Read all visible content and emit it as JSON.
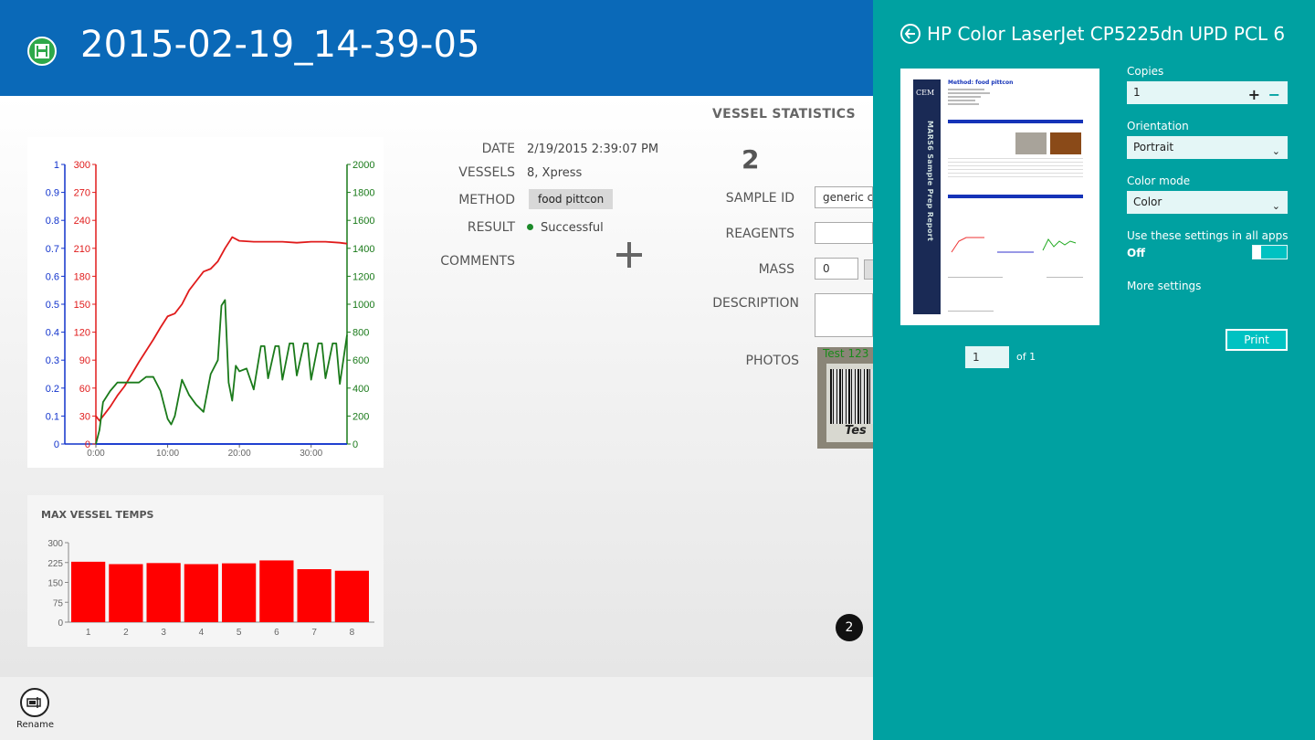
{
  "header": {
    "title": "2015-02-19_14-39-05",
    "save_icon": "save-icon"
  },
  "details": {
    "date_label": "DATE",
    "date_value": "2/19/2015 2:39:07 PM",
    "vessels_label": "VESSELS",
    "vessels_value": "8, Xpress",
    "method_label": "METHOD",
    "method_value": "food pittcon",
    "result_label": "RESULT",
    "result_value": "Successful",
    "comments_label": "COMMENTS"
  },
  "vessel_statistics": {
    "title": "VESSEL STATISTICS",
    "count": "2",
    "sample_id_label": "SAMPLE ID",
    "sample_id_value": "generic che",
    "reagents_label": "REAGENTS",
    "reagents_value": "",
    "mass_label": "MASS",
    "mass_value": "0",
    "description_label": "DESCRIPTION",
    "photos_label": "PHOTOS",
    "photo_caption": "Test 123",
    "photo_text": "Tes"
  },
  "badge": "2",
  "appbar": {
    "rename_label": "Rename"
  },
  "print_pane": {
    "printer_name": "HP Color LaserJet CP5225dn UPD PCL 6",
    "copies_label": "Copies",
    "copies_value": "1",
    "orientation_label": "Orientation",
    "orientation_value": "Portrait",
    "color_mode_label": "Color mode",
    "color_mode_value": "Color",
    "use_settings_label": "Use these settings in all apps",
    "use_settings_state": "Off",
    "more_settings": "More settings",
    "print_button": "Print",
    "page_value": "1",
    "page_of": "of 1",
    "preview": {
      "method_title": "Method:  food pittcon",
      "side_text": "MARS6 Sample Prep Report",
      "logo": "CEM"
    }
  },
  "colors": {
    "header_bg": "#0a69b8",
    "print_pane_bg": "#00a1a1",
    "temperature": "#e01b1b",
    "pressure": "#1133cc",
    "power": "#1a7a1a",
    "bar": "#ff0000"
  },
  "chart_data": [
    {
      "type": "line",
      "title": "",
      "x_ticks": [
        "0:00",
        "10:00",
        "20:00",
        "30:00"
      ],
      "x_unit_minutes": [
        0,
        10,
        20,
        30
      ],
      "xlim": [
        0,
        35
      ],
      "axes": {
        "left_blue": {
          "ylim": [
            0,
            1
          ],
          "ticks": [
            "0",
            "0.1",
            "0.2",
            "0.3",
            "0.4",
            "0.5",
            "0.6",
            "0.7",
            "0.8",
            "0.9",
            "1"
          ]
        },
        "left_red": {
          "ylim": [
            0,
            300
          ],
          "ticks": [
            "0",
            "30",
            "60",
            "90",
            "120",
            "150",
            "180",
            "210",
            "240",
            "270",
            "300"
          ]
        },
        "right_green": {
          "ylim": [
            0,
            2000
          ],
          "ticks": [
            "0",
            "200",
            "400",
            "600",
            "800",
            "1000",
            "1200",
            "1400",
            "1600",
            "1800",
            "2000"
          ]
        }
      },
      "series": [
        {
          "axis": "left_red",
          "x": [
            0,
            0.5,
            1,
            2,
            3,
            4,
            5,
            6,
            7,
            8,
            9,
            10,
            11,
            12,
            13,
            14,
            15,
            16,
            17,
            18,
            19,
            20,
            22,
            24,
            26,
            28,
            30,
            32,
            34,
            35
          ],
          "y": [
            30,
            25,
            30,
            40,
            52,
            62,
            75,
            88,
            100,
            112,
            125,
            137,
            140,
            150,
            165,
            175,
            185,
            188,
            196,
            210,
            222,
            218,
            217,
            217,
            217,
            216,
            217,
            217,
            216,
            215
          ]
        },
        {
          "axis": "left_blue",
          "x": [
            0,
            35
          ],
          "y": [
            0,
            0
          ]
        },
        {
          "axis": "right_green",
          "x": [
            0,
            0.5,
            1,
            2,
            3,
            4,
            5,
            6,
            7,
            8,
            9,
            10,
            10.5,
            11,
            12,
            13,
            14,
            15,
            16,
            17,
            17.5,
            18,
            18.5,
            19,
            19.5,
            20,
            21,
            22,
            23,
            23.5,
            24,
            25,
            25.5,
            26,
            27,
            27.5,
            28,
            29,
            29.5,
            30,
            31,
            31.5,
            32,
            33,
            33.5,
            34,
            35
          ],
          "y": [
            0,
            100,
            300,
            380,
            440,
            440,
            440,
            440,
            480,
            480,
            380,
            180,
            140,
            200,
            460,
            350,
            280,
            230,
            500,
            600,
            990,
            1030,
            440,
            310,
            560,
            520,
            540,
            390,
            700,
            700,
            470,
            700,
            700,
            460,
            720,
            720,
            490,
            720,
            720,
            460,
            720,
            720,
            470,
            720,
            720,
            430,
            780
          ]
        }
      ]
    },
    {
      "type": "bar",
      "title": "MAX VESSEL TEMPS",
      "categories": [
        "1",
        "2",
        "3",
        "4",
        "5",
        "6",
        "7",
        "8"
      ],
      "values": [
        228,
        219,
        223,
        219,
        222,
        233,
        200,
        194
      ],
      "ylim": [
        0,
        300
      ],
      "y_ticks": [
        "0",
        "75",
        "150",
        "225",
        "300"
      ]
    }
  ]
}
